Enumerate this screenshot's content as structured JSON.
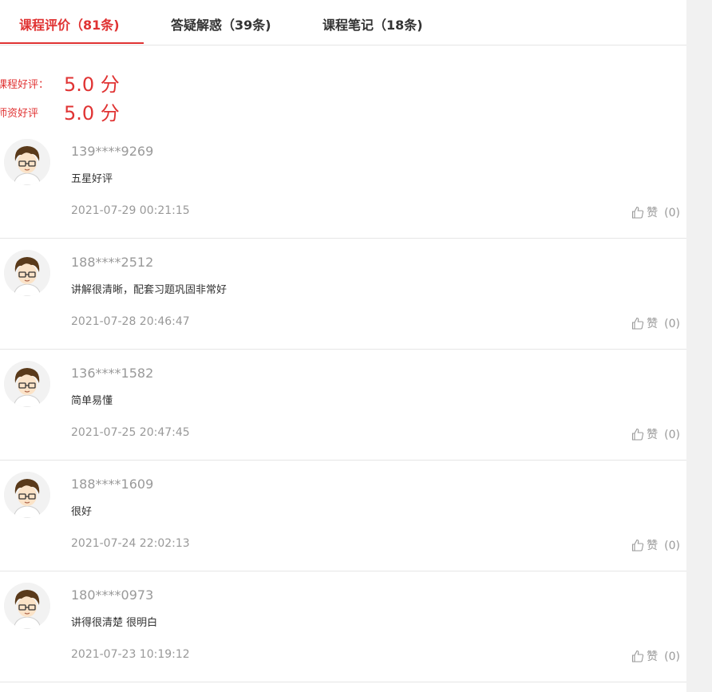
{
  "tabs": [
    {
      "label": "课程评价（81条)"
    },
    {
      "label": "答疑解惑（39条)"
    },
    {
      "label": "课程笔记（18条)"
    }
  ],
  "ratings": [
    {
      "label": "课程好评：",
      "value": "5.0 分"
    },
    {
      "label": "师资好评",
      "value": "5.0 分"
    }
  ],
  "like_label": "赞",
  "reviews": [
    {
      "user": "139****9269",
      "comment": "五星好评",
      "time": "2021-07-29 00:21:15",
      "likes": "(0)"
    },
    {
      "user": "188****2512",
      "comment": "讲解很清晰，配套习题巩固非常好",
      "time": "2021-07-28 20:46:47",
      "likes": "(0)"
    },
    {
      "user": "136****1582",
      "comment": "简单易懂",
      "time": "2021-07-25 20:47:45",
      "likes": "(0)"
    },
    {
      "user": "188****1609",
      "comment": "很好",
      "time": "2021-07-24 22:02:13",
      "likes": "(0)"
    },
    {
      "user": "180****0973",
      "comment": "讲得很清楚 很明白",
      "time": "2021-07-23 10:19:12",
      "likes": "(0)"
    }
  ],
  "colors": {
    "accent": "#e03333",
    "muted": "#999999"
  }
}
